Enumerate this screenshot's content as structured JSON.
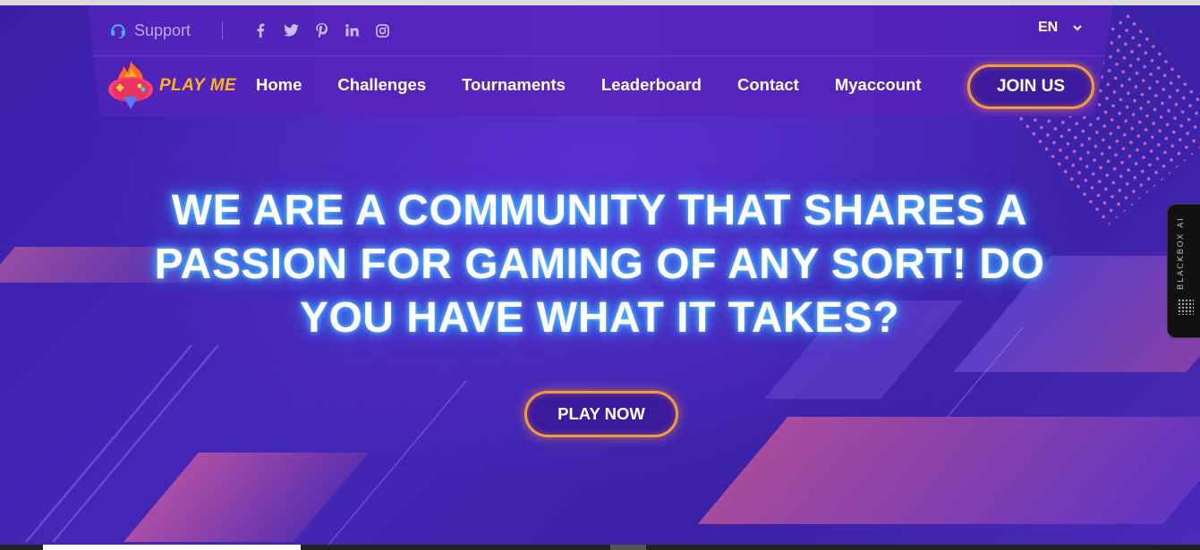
{
  "topbar": {
    "support_label": "Support",
    "social": [
      {
        "icon": "facebook-icon",
        "glyph": "f"
      },
      {
        "icon": "twitter-icon",
        "glyph": "t"
      },
      {
        "icon": "pinterest-icon",
        "glyph": "p"
      },
      {
        "icon": "linkedin-icon",
        "glyph": "in"
      },
      {
        "icon": "instagram-icon",
        "glyph": "ig"
      }
    ],
    "language": "EN"
  },
  "brand": {
    "name": "PLAY ME"
  },
  "nav": {
    "items": [
      "Home",
      "Challenges",
      "Tournaments",
      "Leaderboard",
      "Contact",
      "Myaccount"
    ],
    "join_label": "JOIN US"
  },
  "hero": {
    "title": "WE ARE A COMMUNITY THAT SHARES A PASSION FOR GAMING OF ANY SORT! DO YOU HAVE WHAT IT TAKES?",
    "cta_label": "PLAY NOW"
  },
  "extension": {
    "label": "BLACKBOX AI"
  },
  "colors": {
    "accent": "#f39a3e",
    "brand_text": "#ffb320",
    "background": "#3a1fa6",
    "glow": "#3aa6ff"
  }
}
